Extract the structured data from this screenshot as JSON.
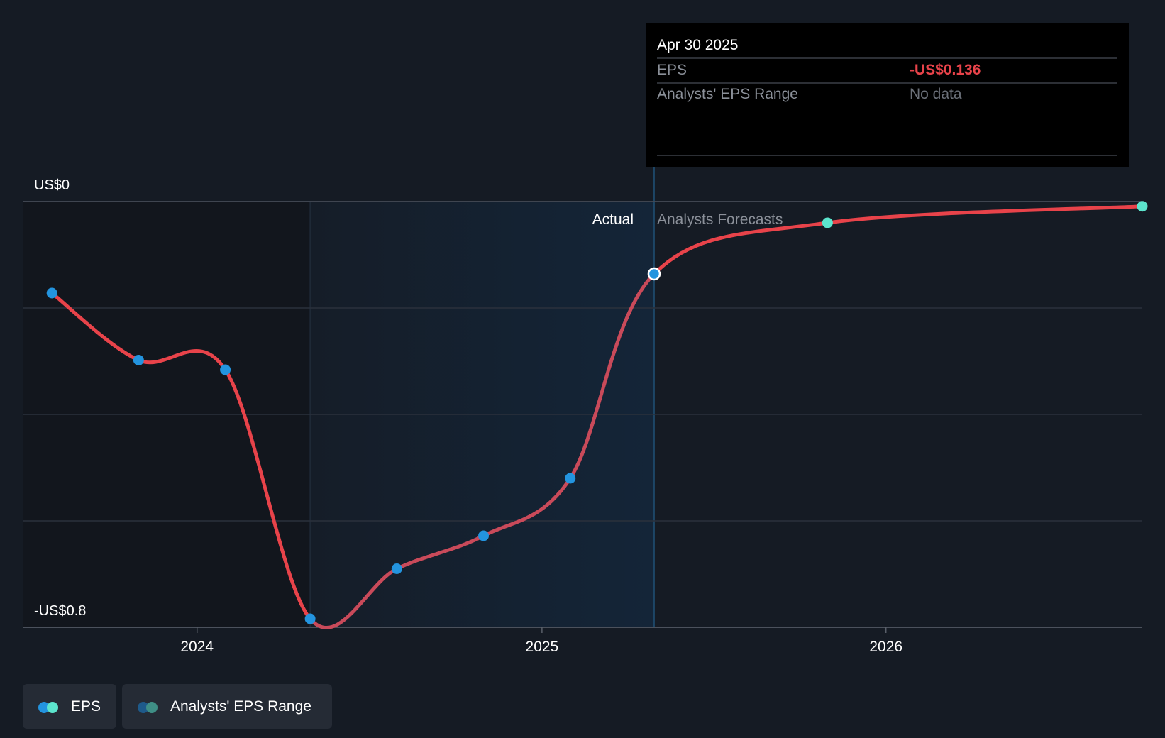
{
  "tooltip": {
    "date": "Apr 30 2025",
    "rows": [
      {
        "label": "EPS",
        "value": "-US$0.136",
        "value_color": "#e8434a"
      },
      {
        "label": "Analysts' EPS Range",
        "value": "No data",
        "value_color": "#6b7079"
      }
    ]
  },
  "colors": {
    "background": "#151b24",
    "past_shade": "#12161d",
    "actual_band_start": "#151d28",
    "actual_band_end": "#142538",
    "line": "#e8434a",
    "line_actual_band": "#c94a5a",
    "actual_dot": "#2394df",
    "forecast_dot": "#5ce5cd",
    "grid": "#2b313c",
    "axis_text": "#ffffff"
  },
  "legend": {
    "items": [
      {
        "label": "EPS",
        "dot_colors": [
          "#2394df",
          "#5ce5cd"
        ]
      },
      {
        "label": "Analysts' EPS Range",
        "dot_colors": [
          "#1e5a8a",
          "#3f8f86"
        ]
      }
    ]
  },
  "chart_data": {
    "type": "line",
    "title": "",
    "xlabel": "",
    "ylabel": "",
    "y_tick_labels": [
      {
        "value": 0,
        "label": "US$0"
      },
      {
        "value": -0.8,
        "label": "-US$0.8"
      }
    ],
    "ylim": [
      -0.8,
      0
    ],
    "y_gridlines": [
      0,
      -0.2,
      -0.4,
      -0.6,
      -0.8
    ],
    "x_ticks": [
      "2024",
      "2025",
      "2026"
    ],
    "xlim": [
      "2023-06-30",
      "2026-09-30"
    ],
    "region_labels": {
      "actual": "Actual",
      "forecast": "Analysts Forecasts"
    },
    "actual_band": [
      "2024-04-30",
      "2025-04-30"
    ],
    "series": [
      {
        "name": "EPS",
        "points": [
          {
            "x": "2023-07-31",
            "y": -0.172
          },
          {
            "x": "2023-10-31",
            "y": -0.298
          },
          {
            "x": "2024-01-31",
            "y": -0.316
          },
          {
            "x": "2024-04-30",
            "y": -0.784
          },
          {
            "x": "2024-07-31",
            "y": -0.69
          },
          {
            "x": "2024-10-31",
            "y": -0.628
          },
          {
            "x": "2025-01-31",
            "y": -0.52
          },
          {
            "x": "2025-04-30",
            "y": -0.136
          },
          {
            "x": "2025-10-31",
            "y": -0.04,
            "forecast": true
          },
          {
            "x": "2026-09-30",
            "y": -0.009,
            "forecast": true
          }
        ]
      }
    ],
    "highlighted_point": "2025-04-30",
    "legend_position": "bottom-left"
  }
}
